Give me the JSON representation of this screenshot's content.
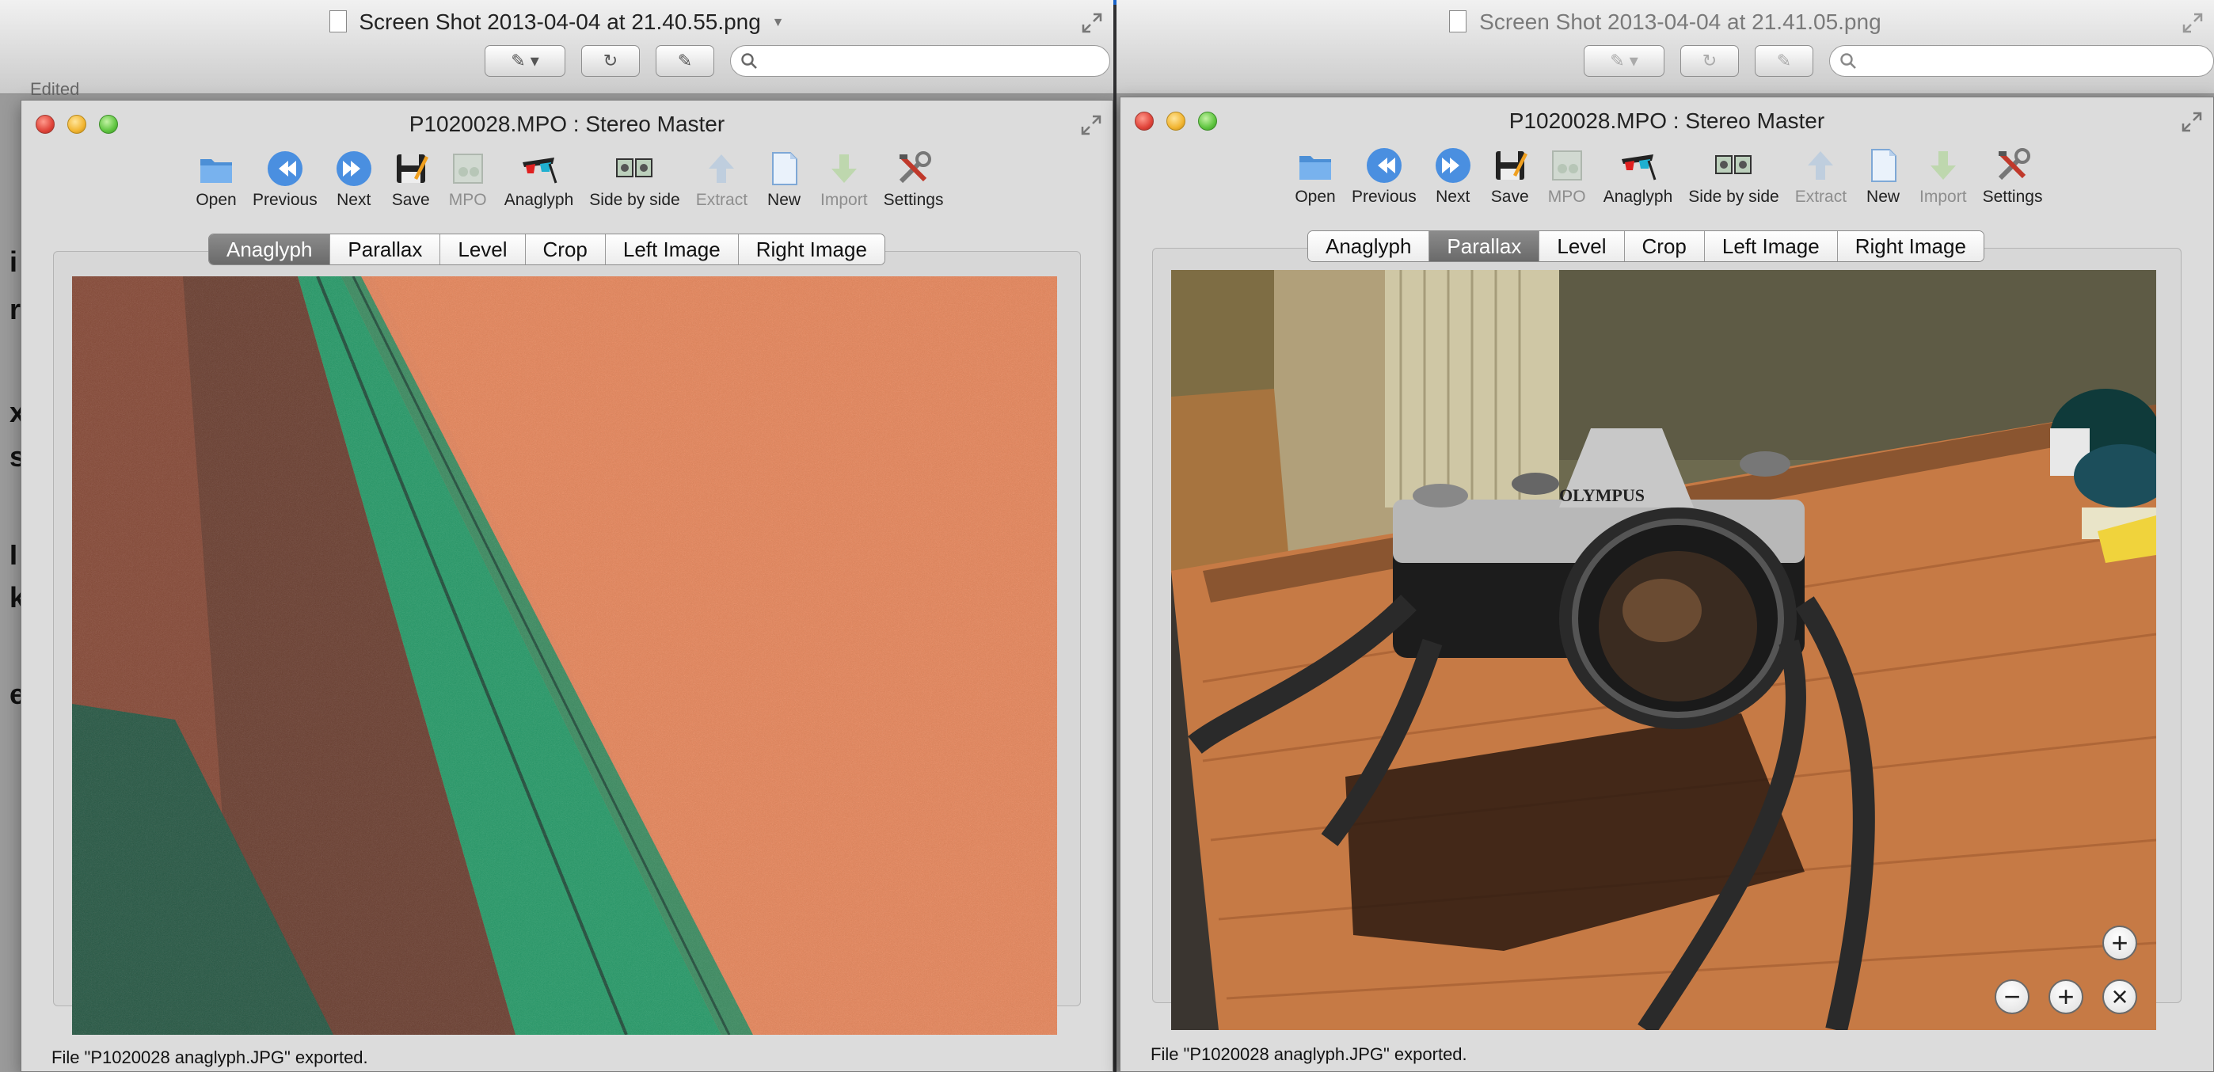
{
  "preview_left": {
    "title": "Screen Shot 2013-04-04 at 21.40.55.png",
    "edited_label": "Edited",
    "behind_letters": [
      "i",
      "r",
      "x",
      "s",
      "I",
      "k",
      "e"
    ]
  },
  "preview_right": {
    "title": "Screen Shot 2013-04-04 at 21.41.05.png"
  },
  "windows": [
    {
      "title": "P1020028.MPO : Stereo Master",
      "toolbar": [
        {
          "label": "Open",
          "icon": "folder-icon",
          "disabled": false
        },
        {
          "label": "Previous",
          "icon": "previous-icon",
          "disabled": false
        },
        {
          "label": "Next",
          "icon": "next-icon",
          "disabled": false
        },
        {
          "label": "Save",
          "icon": "save-icon",
          "disabled": false
        },
        {
          "label": "MPO",
          "icon": "mpo-icon",
          "disabled": true
        },
        {
          "label": "Anaglyph",
          "icon": "anaglyph-glasses-icon",
          "disabled": false
        },
        {
          "label": "Side by side",
          "icon": "side-by-side-icon",
          "disabled": false
        },
        {
          "label": "Extract",
          "icon": "extract-icon",
          "disabled": true
        },
        {
          "label": "New",
          "icon": "new-document-icon",
          "disabled": false
        },
        {
          "label": "Import",
          "icon": "import-icon",
          "disabled": true
        },
        {
          "label": "Settings",
          "icon": "settings-tools-icon",
          "disabled": false
        }
      ],
      "tabs": [
        "Anaglyph",
        "Parallax",
        "Level",
        "Crop",
        "Left Image",
        "Right Image"
      ],
      "active_tab": "Anaglyph",
      "status": "File \"P1020028 anaglyph.JPG\" exported."
    },
    {
      "title": "P1020028.MPO : Stereo Master",
      "toolbar": [
        {
          "label": "Open",
          "icon": "folder-icon",
          "disabled": false
        },
        {
          "label": "Previous",
          "icon": "previous-icon",
          "disabled": false
        },
        {
          "label": "Next",
          "icon": "next-icon",
          "disabled": false
        },
        {
          "label": "Save",
          "icon": "save-icon",
          "disabled": false
        },
        {
          "label": "MPO",
          "icon": "mpo-icon",
          "disabled": true
        },
        {
          "label": "Anaglyph",
          "icon": "anaglyph-glasses-icon",
          "disabled": false
        },
        {
          "label": "Side by side",
          "icon": "side-by-side-icon",
          "disabled": false
        },
        {
          "label": "Extract",
          "icon": "extract-icon",
          "disabled": true
        },
        {
          "label": "New",
          "icon": "new-document-icon",
          "disabled": false
        },
        {
          "label": "Import",
          "icon": "import-icon",
          "disabled": true
        },
        {
          "label": "Settings",
          "icon": "settings-tools-icon",
          "disabled": false
        }
      ],
      "tabs": [
        "Anaglyph",
        "Parallax",
        "Level",
        "Crop",
        "Left Image",
        "Right Image"
      ],
      "active_tab": "Parallax",
      "status": "File \"P1020028 anaglyph.JPG\" exported.",
      "photo_brand": "OLYMPUS",
      "zoom_controls": {
        "zoom_in": "+",
        "zoom_out": "−",
        "reset": "×"
      }
    }
  ],
  "colors": {
    "active_tab": "#7a7a7a",
    "anaglyph_orange": "#e4885e",
    "anaglyph_green": "#1c9d6b",
    "desk_wood": "#c67a45"
  }
}
